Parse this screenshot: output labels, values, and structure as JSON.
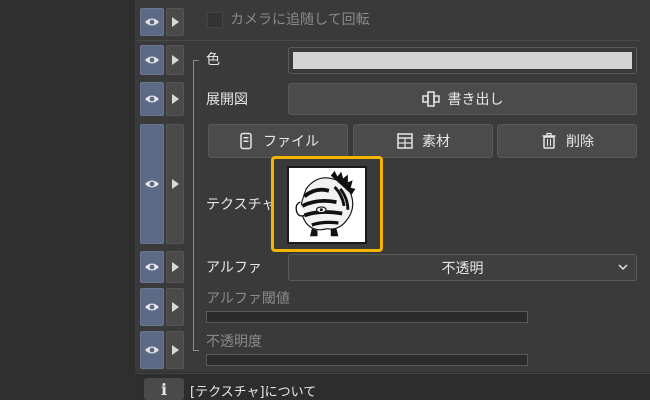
{
  "rows": {
    "camera_follow": {
      "label": "カメラに追随して回転"
    },
    "color": {
      "label": "色",
      "swatch_color": "#d4d4d4"
    },
    "unfold": {
      "label": "展開図",
      "export_label": "書き出し"
    },
    "texture": {
      "label": "テクスチャ",
      "file_label": "ファイル",
      "material_label": "素材",
      "delete_label": "削除"
    },
    "alpha": {
      "label": "アルファ",
      "selected": "不透明"
    },
    "alpha_threshold": {
      "label": "アルファ閾値"
    },
    "opacity": {
      "label": "不透明度"
    }
  },
  "footer": {
    "info_icon": "i",
    "text": "[テクスチャ]について"
  },
  "colors": {
    "accent_highlight": "#f4b400",
    "eye_toggle": "#5d6a85"
  },
  "icons": [
    "eye-icon",
    "expand-arrow-icon",
    "unfold-icon",
    "file-icon",
    "material-icon",
    "trash-icon",
    "chevron-down-icon",
    "info-icon"
  ]
}
